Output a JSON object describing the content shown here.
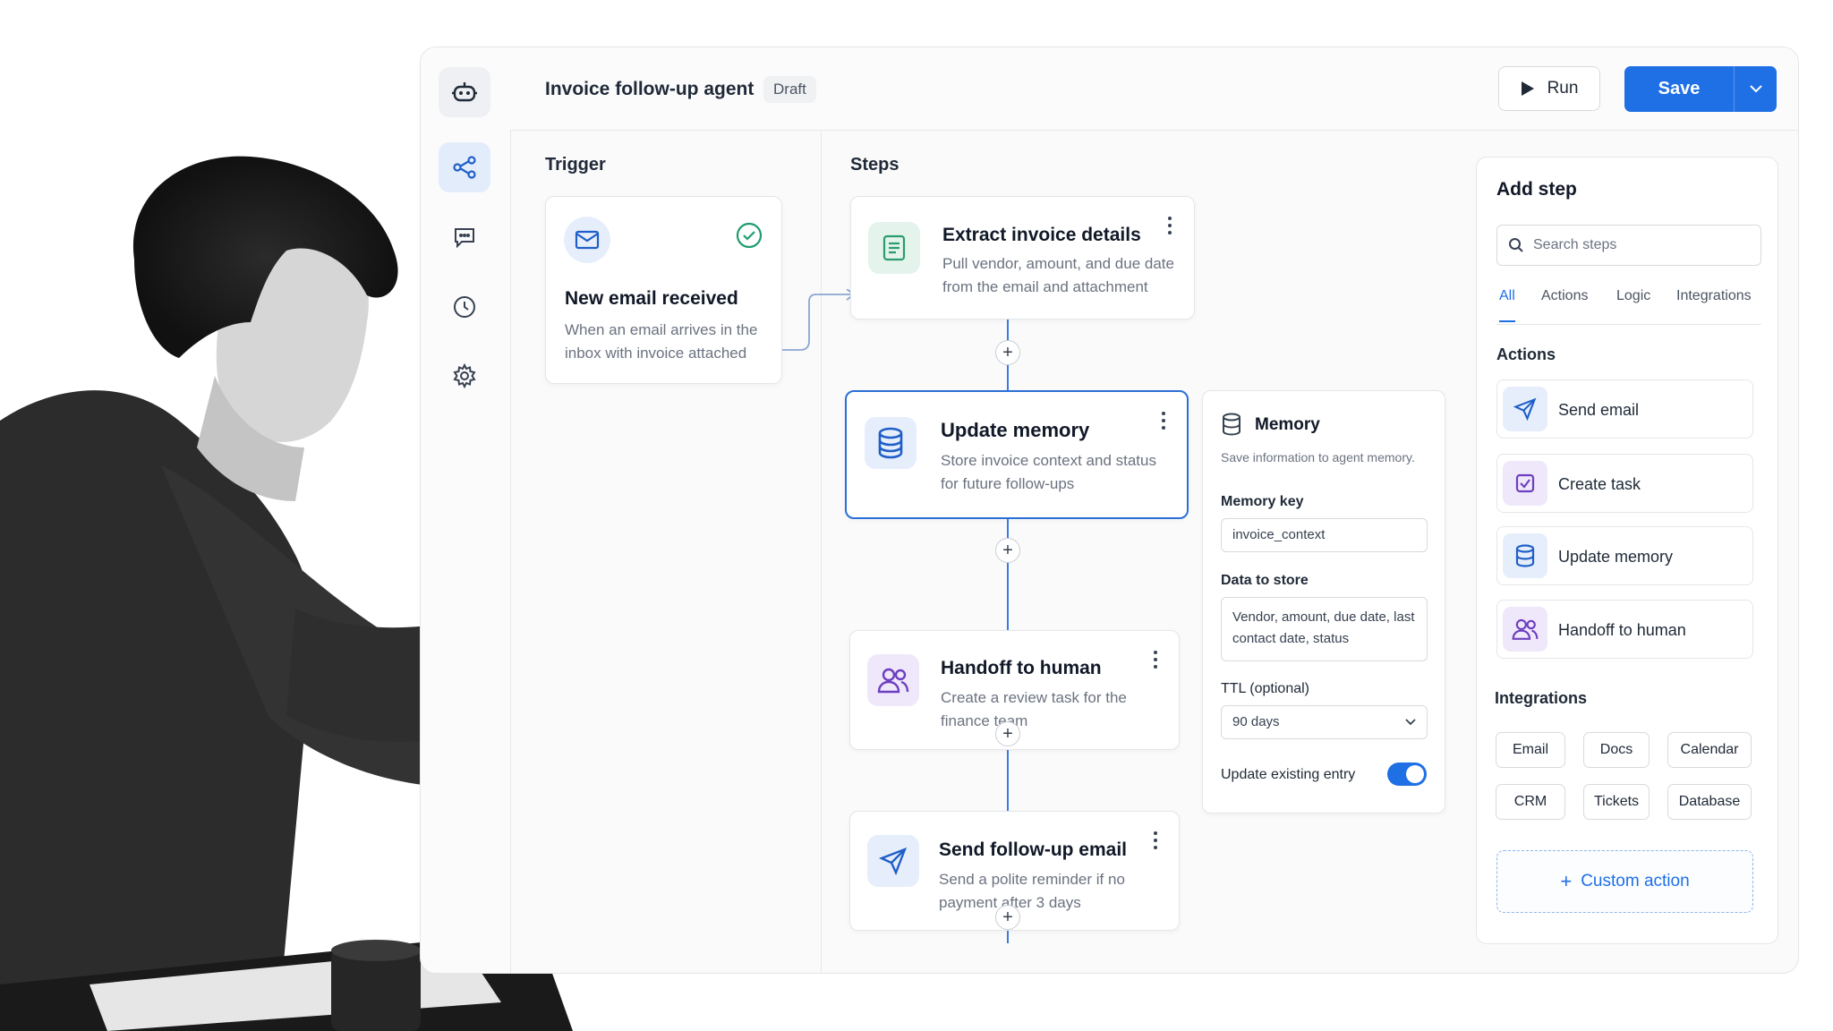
{
  "app": {
    "title": "Invoice follow-up agent",
    "status_badge": "Draft",
    "run_label": "Run",
    "save_label": "Save"
  },
  "sections": {
    "trigger": "Trigger",
    "steps": "Steps"
  },
  "trigger": {
    "title": "New email received",
    "description": "When an email arrives in the inbox with invoice attached"
  },
  "steps": [
    {
      "title": "Extract invoice details",
      "description": "Pull vendor, amount, and due date from the email and attachment",
      "icon": "document-icon",
      "color": "#2a9d6e"
    },
    {
      "title": "Update memory",
      "description": "Store invoice context and status for future follow-ups",
      "icon": "database-icon",
      "color": "#1f5fc8"
    },
    {
      "title": "Handoff to human",
      "description": "Create a review task for the finance team",
      "icon": "users-icon",
      "color": "#6d3fc0"
    },
    {
      "title": "Send follow-up email",
      "description": "Send a polite reminder if no payment after 3 days",
      "icon": "send-icon",
      "color": "#1f5fc8"
    }
  ],
  "memory_panel": {
    "title": "Memory",
    "subtitle": "Save information to agent memory.",
    "key_label": "Memory key",
    "key_value": "invoice_context",
    "data_label": "Data to store",
    "data_value": "Vendor, amount, due date, last contact date, status",
    "ttl_label": "TTL (optional)",
    "ttl_value": "90 days",
    "update_label": "Update existing entry",
    "update_enabled": true
  },
  "add_step": {
    "title": "Add step",
    "search_placeholder": "Search steps",
    "tabs": [
      "All",
      "Actions",
      "Logic",
      "Integrations"
    ],
    "active_tab": "All",
    "actions_heading": "Actions",
    "actions": [
      {
        "label": "Send email",
        "icon": "send-icon"
      },
      {
        "label": "Create task",
        "icon": "checkbox-icon"
      },
      {
        "label": "Update memory",
        "icon": "database-icon"
      },
      {
        "label": "Handoff to human",
        "icon": "users-icon"
      }
    ],
    "integrations_heading": "Integrations",
    "integrations": [
      "Email",
      "Docs",
      "Calendar",
      "CRM",
      "Tickets",
      "Database"
    ],
    "custom_action": "Custom action"
  },
  "colors": {
    "accent": "#1f6fe5",
    "success": "#1f9d6e"
  }
}
